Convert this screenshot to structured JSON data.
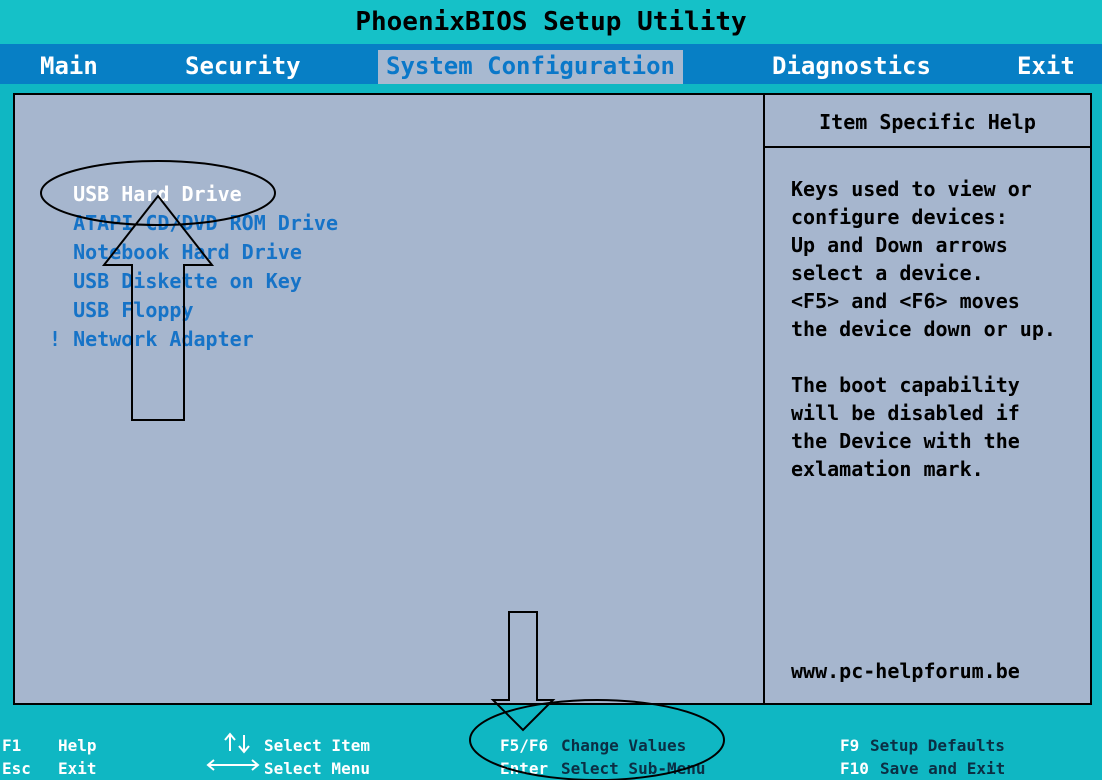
{
  "title": "PhoenixBIOS Setup Utility",
  "tabs": [
    {
      "label": "Main"
    },
    {
      "label": "Security"
    },
    {
      "label": "System Configuration"
    },
    {
      "label": "Diagnostics"
    },
    {
      "label": "Exit"
    }
  ],
  "active_tab": "System Configuration",
  "boot_items": [
    {
      "label": "  USB Hard Drive",
      "selected": true
    },
    {
      "label": "  ATAPI CD/DVD ROM Drive"
    },
    {
      "label": "  Notebook Hard Drive"
    },
    {
      "label": "  USB Diskette on Key"
    },
    {
      "label": "  USB Floppy"
    },
    {
      "label": "! Network Adapter"
    }
  ],
  "help": {
    "title": "Item Specific Help",
    "body": "Keys used to view or\nconfigure devices:\nUp and Down arrows\nselect a device.\n<F5> and <F6> moves\nthe device down or up.\n\nThe boot capability\nwill be disabled if\nthe Device with the\nexlamation mark.",
    "footer": "www.pc-helpforum.be"
  },
  "footer": {
    "f1_key": "F1",
    "f1_desc": "Help",
    "esc_key": "Esc",
    "esc_desc": "Exit",
    "updown_desc": "Select Item",
    "leftright_desc": "Select Menu",
    "f5f6_key": "F5/F6",
    "f5f6_desc": "Change Values",
    "enter_key": "Enter",
    "enter_desc": "Select  Sub-Menu",
    "f9_key": "F9",
    "f9_desc": "Setup Defaults",
    "f10_key": "F10",
    "f10_desc": "Save and Exit"
  },
  "colors": {
    "title_bg": "#15c1c8",
    "menubar_bg": "#077fc5",
    "panel_bg": "#a6b6ce",
    "item_text": "#1673c7",
    "selected_text": "#ffffff",
    "footer_bg": "#0fb7c3"
  }
}
